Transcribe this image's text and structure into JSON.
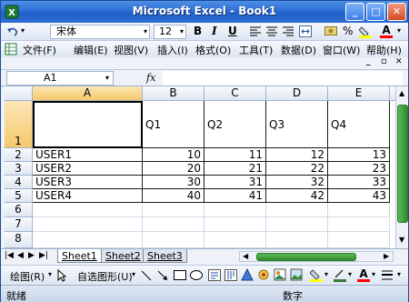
{
  "window": {
    "title": "Microsoft Excel - Book1"
  },
  "toolbar": {
    "font_name": "宋体",
    "font_size": "12",
    "bold": "B",
    "italic": "I",
    "underline": "U",
    "percent": "%",
    "font_color_letter": "A"
  },
  "menu": {
    "items": [
      "文件(F)",
      "编辑(E)",
      "视图(V)",
      "插入(I)",
      "格式(O)",
      "工具(T)",
      "数据(D)",
      "窗口(W)",
      "帮助(H)"
    ]
  },
  "formula_bar": {
    "name_box": "A1",
    "fx": "fx",
    "value": ""
  },
  "grid": {
    "columns": [
      "A",
      "B",
      "C",
      "D",
      "E"
    ],
    "rows": [
      "1",
      "2",
      "3",
      "4",
      "5",
      "6",
      "7",
      "8"
    ],
    "cells": [
      [
        "",
        "Q1",
        "Q2",
        "Q3",
        "Q4"
      ],
      [
        "USER1",
        "10",
        "11",
        "12",
        "13"
      ],
      [
        "USER2",
        "20",
        "21",
        "22",
        "23"
      ],
      [
        "USER3",
        "30",
        "31",
        "32",
        "33"
      ],
      [
        "USER4",
        "40",
        "41",
        "42",
        "43"
      ]
    ],
    "selected_cell": "A1"
  },
  "sheets": [
    "Sheet1",
    "Sheet2",
    "Sheet3"
  ],
  "active_sheet": "Sheet1",
  "draw_toolbar": {
    "draw_label": "绘图(R)",
    "autoshape_label": "自选图形(U)"
  },
  "status": {
    "left": "就绪",
    "right": "数字"
  },
  "colors": {
    "title_bar": "#2f6fd6",
    "scroll_thumb": "#3a9a35",
    "selection_header": "#f6c96b"
  }
}
